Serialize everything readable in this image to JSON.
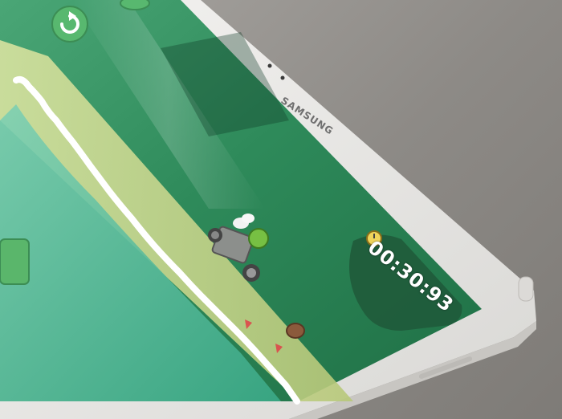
{
  "device": {
    "brand": "SAMSUNG"
  },
  "game": {
    "timer": "00:30:93",
    "icons": [
      "restart-icon",
      "stopwatch-icon"
    ]
  },
  "colors": {
    "tablet_frame": "#e9e8e6",
    "screen_green": "#2f8f5e",
    "ground_light": "#c9d78e",
    "timer_panel": "#1f5b3b"
  }
}
